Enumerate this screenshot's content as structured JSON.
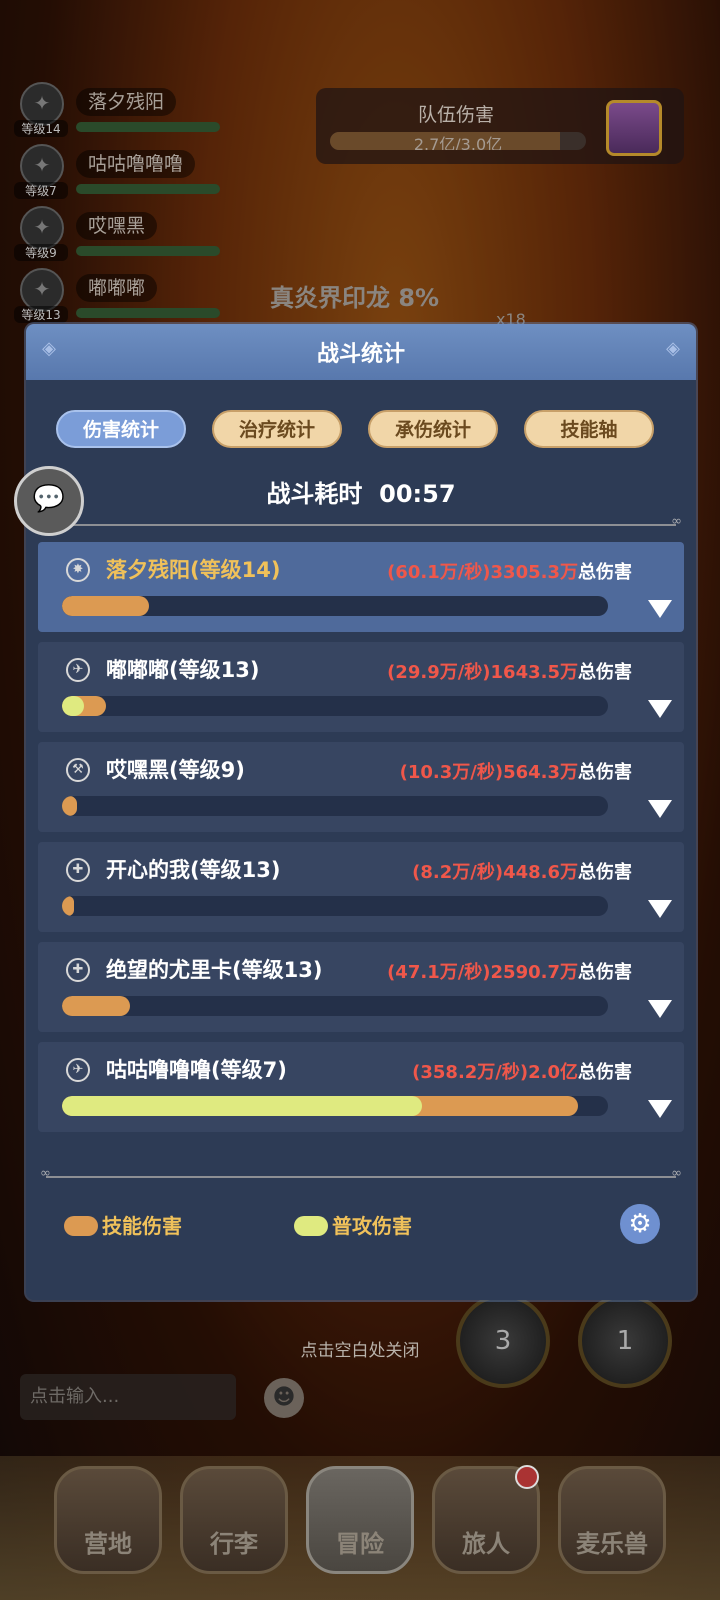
{
  "background": {
    "team_damage": {
      "title": "队伍伤害",
      "value": "2.7亿/3.0亿",
      "fill_fraction": 0.9
    },
    "members": [
      {
        "level": "等级14",
        "name": "落夕残阳",
        "icon": "sun-emblem-icon"
      },
      {
        "level": "等级7",
        "name": "咕咕噜噜噜",
        "icon": "compass-icon"
      },
      {
        "level": "等级9",
        "name": "哎嘿黑",
        "icon": "wrench-icon"
      },
      {
        "level": "等级13",
        "name": "嘟嘟嘟",
        "icon": "compass-icon"
      }
    ],
    "boss": {
      "name": "真炎界印龙 8%",
      "multiplier": "x18"
    },
    "close_hint": "点击空白处关闭",
    "chat_input_placeholder": "点击输入...",
    "skill_orb_counts": [
      "3",
      "1"
    ]
  },
  "nav": [
    {
      "label": "营地"
    },
    {
      "label": "行李"
    },
    {
      "label": "冒险"
    },
    {
      "label": "旅人"
    },
    {
      "label": "麦乐兽"
    }
  ],
  "modal": {
    "title": "战斗统计",
    "tabs": [
      {
        "label": "伤害统计",
        "active": true
      },
      {
        "label": "治疗统计",
        "active": false
      },
      {
        "label": "承伤统计",
        "active": false
      },
      {
        "label": "技能轴",
        "active": false
      }
    ],
    "duration_label": "战斗耗时",
    "duration_value": "00:57",
    "total_damage_suffix": "总伤害",
    "rows": [
      {
        "name": "落夕残阳(等级14)",
        "dps": "(60.1万/秒)",
        "total": "3305.3万",
        "skill_fraction": 0.16,
        "normal_fraction": 0.0,
        "icon": "sun-emblem-icon"
      },
      {
        "name": "嘟嘟嘟(等级13)",
        "dps": "(29.9万/秒)",
        "total": "1643.5万",
        "skill_fraction": 0.08,
        "normal_fraction": 0.04,
        "icon": "compass-icon"
      },
      {
        "name": "哎嘿黑(等级9)",
        "dps": "(10.3万/秒)",
        "total": "564.3万",
        "skill_fraction": 0.027,
        "normal_fraction": 0.0,
        "icon": "wrench-icon"
      },
      {
        "name": "开心的我(等级13)",
        "dps": "(8.2万/秒)",
        "total": "448.6万",
        "skill_fraction": 0.022,
        "normal_fraction": 0.0,
        "icon": "crosshair-icon"
      },
      {
        "name": "绝望的尤里卡(等级13)",
        "dps": "(47.1万/秒)",
        "total": "2590.7万",
        "skill_fraction": 0.125,
        "normal_fraction": 0.0,
        "icon": "crosshair-icon"
      },
      {
        "name": "咕咕噜噜噜(等级7)",
        "dps": "(358.2万/秒)",
        "total": "2.0亿",
        "skill_fraction": 0.945,
        "normal_fraction": 0.66,
        "icon": "compass-icon"
      }
    ],
    "legend": {
      "skill": "技能伤害",
      "normal": "普攻伤害"
    },
    "colors": {
      "skill": "#dc9a52",
      "normal": "#dfea80",
      "dps_text": "#f0574a",
      "highlight_name": "#f0c15a"
    }
  }
}
